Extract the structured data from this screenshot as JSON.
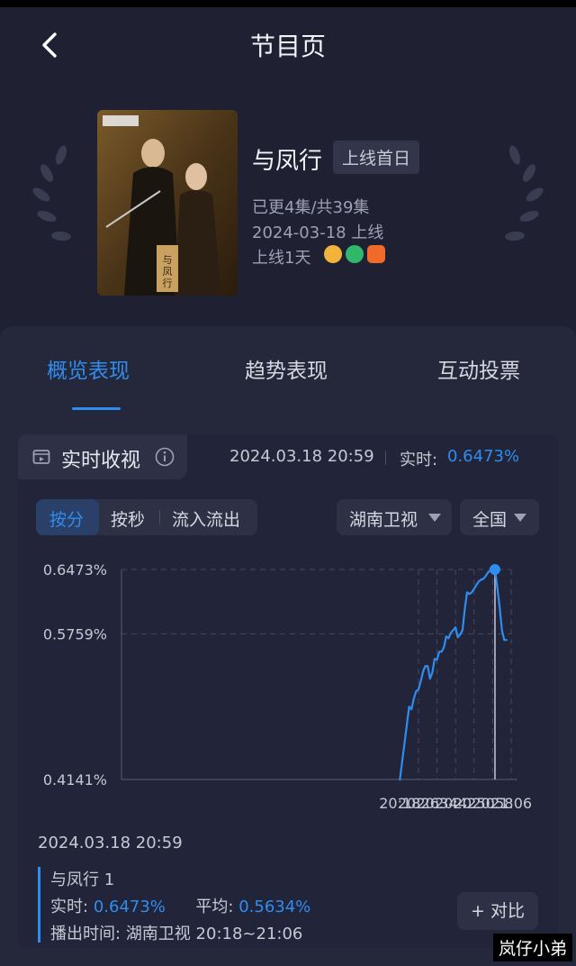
{
  "header": {
    "title": "节目页"
  },
  "show": {
    "name": "与凤行",
    "badge": "上线首日",
    "episodes": "已更4集/共39集",
    "release": "2024-03-18 上线",
    "online_days": "上线1天",
    "platform_icons": [
      "mango-tv-icon",
      "tencent-video-icon",
      "iqiyi-icon"
    ],
    "poster_text": "与凤行"
  },
  "tabs": [
    "概览表现",
    "趋势表现",
    "互动投票"
  ],
  "realtime": {
    "label": "实时收视",
    "time": "2024.03.18 20:59",
    "cap": "实时:",
    "value": "0.6473%"
  },
  "segments": [
    "按分",
    "按秒",
    "流入流出"
  ],
  "dropdowns": {
    "channel": "湖南卫视",
    "region": "全国"
  },
  "chart_data": {
    "type": "line",
    "x_ticks": [
      "20:18",
      "20:26",
      "20:34",
      "20:42",
      "20:50",
      "20:58",
      "21:06"
    ],
    "y_ticks": [
      "0.6473%",
      "0.5759%",
      "0.4141%"
    ],
    "ylim": [
      0.4141,
      0.6473
    ],
    "x": [
      "20:18",
      "20:20",
      "20:22",
      "20:23",
      "20:24",
      "20:25",
      "20:26",
      "20:27",
      "20:28",
      "20:29",
      "20:30",
      "20:31",
      "20:32",
      "20:33",
      "20:34",
      "20:35",
      "20:36",
      "20:37",
      "20:38",
      "20:39",
      "20:40",
      "20:41",
      "20:42",
      "20:43",
      "20:44",
      "20:45",
      "20:46",
      "20:47",
      "20:48",
      "20:49",
      "20:50",
      "20:51",
      "20:52",
      "20:53",
      "20:54",
      "20:55",
      "20:56",
      "20:57",
      "20:58",
      "20:59",
      "21:00",
      "21:01",
      "21:02",
      "21:03",
      "21:04"
    ],
    "values": [
      0.414,
      0.454,
      0.495,
      0.492,
      0.504,
      0.512,
      0.514,
      0.523,
      0.534,
      0.54,
      0.54,
      0.526,
      0.533,
      0.548,
      0.547,
      0.556,
      0.556,
      0.561,
      0.573,
      0.571,
      0.577,
      0.58,
      0.583,
      0.572,
      0.575,
      0.58,
      0.604,
      0.622,
      0.62,
      0.622,
      0.626,
      0.63,
      0.634,
      0.636,
      0.637,
      0.64,
      0.644,
      0.646,
      0.646,
      0.6473,
      0.628,
      0.606,
      0.58,
      0.569,
      0.569
    ],
    "marker": {
      "x": "20:59",
      "value": 0.6473
    },
    "grid": true
  },
  "selection": {
    "date": "2024.03.18 20:59",
    "series": "与凤行 1",
    "rt_cap": "实时:",
    "rt_val": "0.6473%",
    "avg_cap": "平均:",
    "avg_val": "0.5634%",
    "broadcast_cap": "播出时间:",
    "broadcast_val": "湖南卫视 20:18~21:06"
  },
  "compare_label": "+ 对比",
  "watermark": "岚仔小弟",
  "colors": {
    "accent": "#2f8df0",
    "background": "#1f2133",
    "panel": "#25283b"
  }
}
